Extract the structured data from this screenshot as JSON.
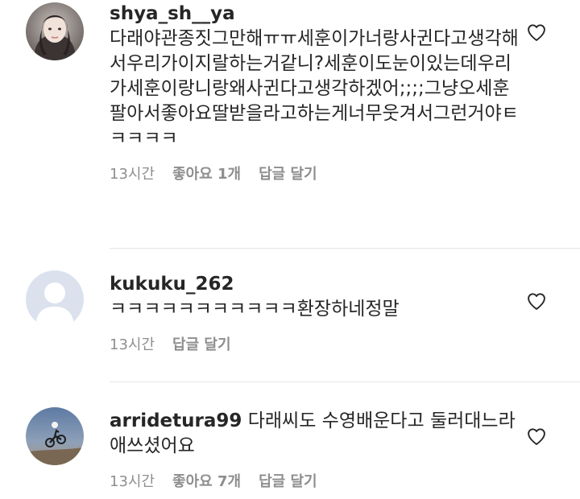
{
  "comments": [
    {
      "username": "shya_sh__ya",
      "text": "다래야관종짓그만해ㅠㅠ세훈이가너랑사귄다고생각해서우리가이지랄하는거같니?세훈이도눈이있는데우리가세훈이랑니랑왜사귄다고생각하겠어;;;;그냥오세훈팔아서좋아요딸받을라고하는게너무웃겨서그런거야ㅌㅋㅋㅋㅋ",
      "time": "13시간",
      "likes": "좋아요 1개",
      "reply": "답글 달기",
      "avatar_icon": "user-photo-avatar"
    },
    {
      "username": "kukuku_262",
      "text": "ㅋㅋㅋㅋㅋㅋㅋㅋㅋㅋㅋ환장하네정말",
      "time": "13시간",
      "likes": "",
      "reply": "답글 달기",
      "avatar_icon": "default-avatar"
    },
    {
      "username": "arridetura99",
      "text": "다래씨도 수영배운다고 둘러대느라 애쓰셨어요",
      "time": "13시간",
      "likes": "좋아요 7개",
      "reply": "답글 달기",
      "avatar_icon": "motorcycle-photo-avatar"
    }
  ],
  "icons": {
    "like": "heart-outline-icon"
  },
  "colors": {
    "text": "#262626",
    "meta": "#8e8e8e",
    "divider": "#e6e6e6",
    "default_avatar_bg": "#dbe2ee"
  }
}
